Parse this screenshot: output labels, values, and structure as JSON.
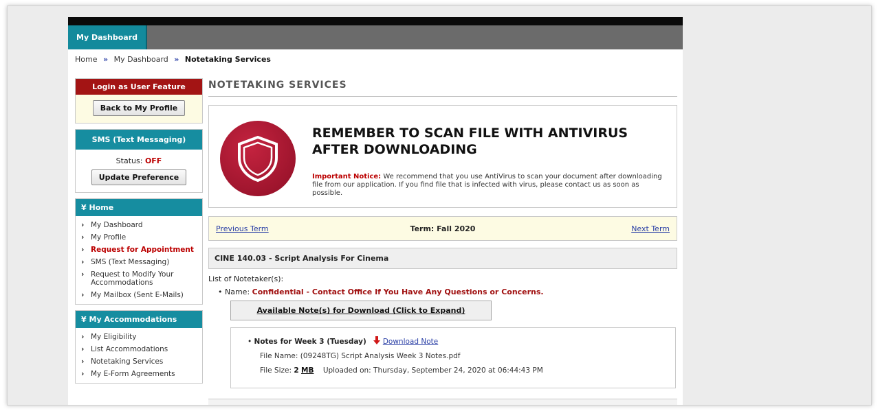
{
  "nav": {
    "tab_label": "My Dashboard"
  },
  "breadcrumb": {
    "home": "Home",
    "sep": "»",
    "dashboard": "My Dashboard",
    "current": "Notetaking Services"
  },
  "sidebar": {
    "login_box": {
      "title": "Login as User Feature",
      "button": "Back to My Profile"
    },
    "sms_box": {
      "title": "SMS (Text Messaging)",
      "status_label": "Status:",
      "status_value": "OFF",
      "button": "Update Preference"
    },
    "home_menu": {
      "title": "Home",
      "items": [
        {
          "label": "My Dashboard"
        },
        {
          "label": "My Profile"
        },
        {
          "label": "Request for Appointment"
        },
        {
          "label": "SMS (Text Messaging)"
        },
        {
          "label": "Request to Modify Your Accommodations"
        },
        {
          "label": "My Mailbox (Sent E-Mails)"
        }
      ]
    },
    "accommodations_menu": {
      "title": "My Accommodations",
      "items": [
        {
          "label": "My Eligibility"
        },
        {
          "label": "List Accommodations"
        },
        {
          "label": "Notetaking Services"
        },
        {
          "label": "My E-Form Agreements"
        }
      ]
    }
  },
  "main": {
    "title": "NOTETAKING SERVICES",
    "notice": {
      "headline_1": "REMEMBER TO SCAN FILE WITH ANTIVIRUS",
      "headline_2": "AFTER DOWNLOADING",
      "label": "Important Notice:",
      "text": "We recommend that you use AntiVirus to scan your document after downloading file from our application. If you find file that is infected with virus, please contact us as soon as possible."
    },
    "term_bar": {
      "previous": "Previous Term",
      "term": "Term: Fall 2020",
      "next": "Next Term"
    },
    "course": "CINE 140.03 - Script Analysis For Cinema",
    "notetakers_label": "List of Notetaker(s):",
    "notetaker": {
      "label": "Name:",
      "value": "Confidential - Contact Office If You Have Any Questions or Concerns."
    },
    "expand_button": "Available Note(s) for Download (Click to Expand)",
    "note": {
      "title": "Notes for Week 3 (Tuesday)",
      "download": "Download Note",
      "file_name_label": "File Name:",
      "file_name": "(09248TG) Script Analysis Week 3 Notes.pdf",
      "file_size_label": "File Size:",
      "file_size_value": "2",
      "file_size_unit": "MB",
      "uploaded_label": "Uploaded on:",
      "uploaded": "Thursday, September 24, 2020 at 06:44:43 PM"
    }
  },
  "colors": {
    "teal": "#168da0",
    "red": "#a31414",
    "link": "#2a3fa6",
    "notice_yellow": "#fdfbe3"
  }
}
